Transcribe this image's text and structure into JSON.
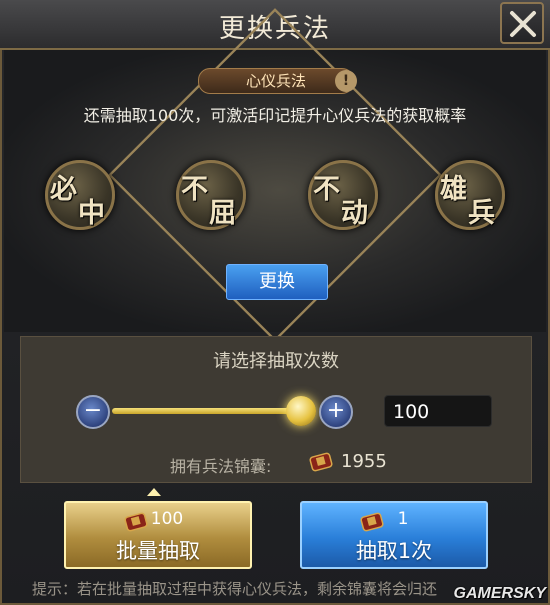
{
  "window": {
    "title": "更换兵法"
  },
  "tactic_tag": {
    "label": "心仪兵法",
    "info_icon": "info-icon",
    "info_glyph": "!"
  },
  "hint_text": "还需抽取100次，可激活印记提升心仪兵法的获取概率",
  "medals": [
    {
      "char1": "必",
      "char2": "中"
    },
    {
      "char1": "不",
      "char2": "屈"
    },
    {
      "char1": "不",
      "char2": "动"
    },
    {
      "char1": "雄",
      "char2": "兵"
    }
  ],
  "swap_button": {
    "label": "更换"
  },
  "selector": {
    "title": "请选择抽取次数",
    "minus_glyph": "−",
    "plus_glyph": "+",
    "value": "100",
    "slider_fraction": 0.9,
    "owned_label": "拥有兵法锦囊:",
    "owned_count": "1955"
  },
  "buttons": {
    "batch": {
      "count": "100",
      "label": "批量抽取"
    },
    "single": {
      "count": "1",
      "label": "抽取1次"
    }
  },
  "bottom_note": "提示：若在批量抽取过程中获得心仪兵法，剩余锦囊将会归还",
  "watermark": "GAMERSKY",
  "colors": {
    "accent_gold": "#c9a52a",
    "button_blue": "#2a7fd9",
    "frame_border": "#6c5a3a"
  }
}
